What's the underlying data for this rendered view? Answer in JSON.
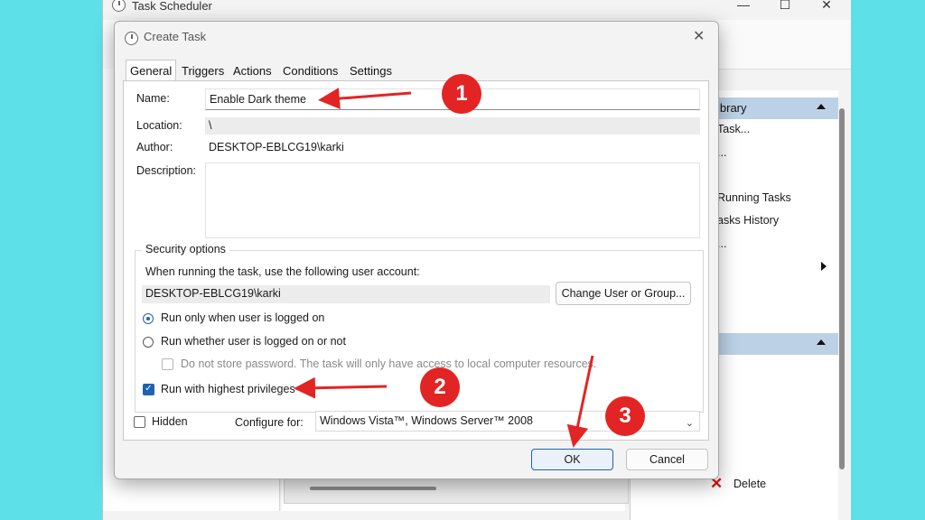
{
  "background_app": {
    "title": "Task Scheduler",
    "window_controls": [
      "—",
      "☐",
      "✕"
    ],
    "actions_pane": {
      "header1": "ibrary",
      "items": [
        "Task...",
        "...",
        "Running Tasks",
        "asks History",
        "...",
        "Delete"
      ],
      "delete_label": "Delete"
    }
  },
  "dialog": {
    "title": "Create Task",
    "close_symbol": "✕",
    "tabs": [
      "General",
      "Triggers",
      "Actions",
      "Conditions",
      "Settings"
    ],
    "general": {
      "name_label": "Name:",
      "name_value": "Enable Dark theme",
      "location_label": "Location:",
      "location_value": "\\",
      "author_label": "Author:",
      "author_value": "DESKTOP-EBLCG19\\karki",
      "description_label": "Description:",
      "description_value": "",
      "security": {
        "legend": "Security options",
        "account_prompt": "When running the task, use the following user account:",
        "account_value": "DESKTOP-EBLCG19\\karki",
        "change_button": "Change User or Group...",
        "radio_logged_on": "Run only when user is logged on",
        "radio_whether": "Run whether user is logged on or not",
        "no_store_password": "Do not store password.  The task will only have access to local computer resources.",
        "highest_privileges": "Run with highest privileges",
        "selected_radio": "logged_on",
        "highest_privileges_checked": true,
        "no_store_password_checked": false
      },
      "hidden_label": "Hidden",
      "hidden_checked": false,
      "configure_label": "Configure for:",
      "configure_value": "Windows Vista™, Windows Server™ 2008"
    },
    "ok_button": "OK",
    "cancel_button": "Cancel"
  },
  "annotations": {
    "badges": [
      "1",
      "2",
      "3"
    ],
    "color": "#e32424"
  },
  "colors": {
    "backdrop": "#5ee0e8",
    "accent": "#1d62b4"
  }
}
